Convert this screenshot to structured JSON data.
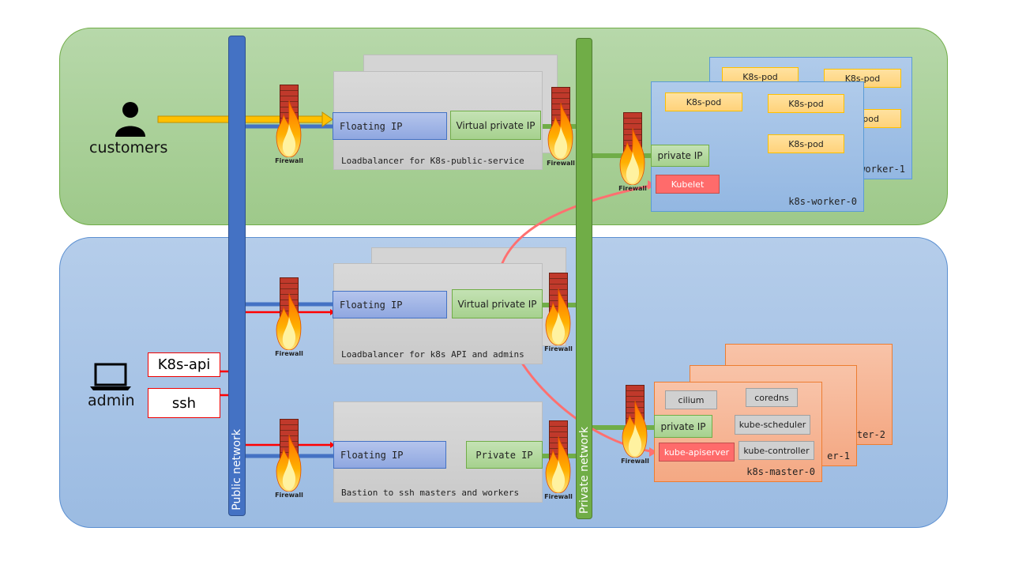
{
  "networks": {
    "public": "Public network",
    "private": "Private network"
  },
  "actors": {
    "customers": "customers",
    "admin": "admin"
  },
  "admin_endpoints": {
    "k8s_api": "K8s-api",
    "ssh": "ssh"
  },
  "firewall_label": "Firewall",
  "lb_public": {
    "floating_ip": "Floating IP",
    "virtual_private_ip": "Virtual private IP",
    "label": "Loadbalancer for K8s-public-service"
  },
  "lb_api": {
    "floating_ip": "Floating IP",
    "virtual_private_ip": "Virtual private IP",
    "label": "Loadbalancer for k8s API and admins"
  },
  "bastion": {
    "floating_ip": "Floating IP",
    "private_ip": "Private IP",
    "label": "Bastion to ssh masters and workers"
  },
  "workers": {
    "worker0": "k8s-worker-0",
    "worker1": "worker-1",
    "pod": "K8s-pod",
    "pod_partial": "pod",
    "private_ip": "private IP",
    "kubelet": "Kubelet"
  },
  "masters": {
    "master0": "k8s-master-0",
    "master1": "er-1",
    "master2": "ter-2",
    "cilium": "cilium",
    "coredns": "coredns",
    "private_ip": "private IP",
    "scheduler": "kube-scheduler",
    "apiserver": "kube-apiserver",
    "controller": "kube-controller"
  },
  "colors": {
    "public_zone": "#a9d18e",
    "private_zone": "#a9c4e8",
    "public_network": "#4472c4",
    "private_network": "#70ad47",
    "admin_link": "#ff0000",
    "internal_link": "#ff7070",
    "customer_flow": "#ffc000"
  }
}
